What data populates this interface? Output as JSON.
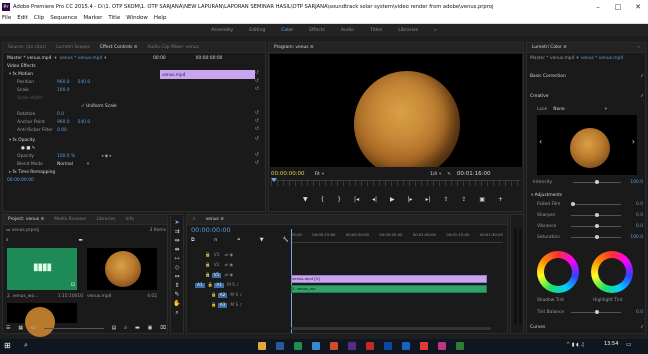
{
  "window": {
    "app_tag": "Pr",
    "title": "Adobe Premiere Pro CC 2015.4 - D:\\1. OTP SKOM\\1. OTP SARJANA\\NEW LAPURAN\\LAPORAN SEMINAR HASIL\\OTP SARJANA\\soundtrack solar system\\video render from adobe\\venus.prproj",
    "controls": [
      "–",
      "□",
      "✕"
    ]
  },
  "menu": [
    "File",
    "Edit",
    "Clip",
    "Sequence",
    "Marker",
    "Title",
    "Window",
    "Help"
  ],
  "workspaces": {
    "items": [
      "Assembly",
      "Editing",
      "Color",
      "Effects",
      "Audio",
      "Titles",
      "Libraries"
    ],
    "active": "Color",
    "more": "»"
  },
  "source_panel": {
    "tabs": [
      "Source: (no clips)",
      "Lumetri Scopes",
      "Effect Controls ≡",
      "Audio Clip Mixer: venus"
    ],
    "active_tab": "Effect Controls ≡",
    "master_clip": "Master * venus.mp4",
    "sequence_clip": "venus * venus.mp4",
    "section": "Video Effects",
    "timecode_left": "00:00",
    "timecode_right": "00:00:00:00",
    "clip_label": "venus.mp4",
    "motion": {
      "label": "Motion",
      "position_label": "Position",
      "position_x": "960.0",
      "position_y": "540.0",
      "scale_label": "Scale",
      "scale_value": "100.0",
      "scale_width_label": "Scale Width",
      "uniform_scale": "Uniform Scale",
      "rotation_label": "Rotation",
      "rotation_value": "0.0",
      "anchor_label": "Anchor Point",
      "anchor_x": "960.0",
      "anchor_y": "540.0",
      "flicker_label": "Anti-flicker Filter",
      "flicker_value": "0.00"
    },
    "opacity": {
      "label": "Opacity",
      "opacity_label": "Opacity",
      "opacity_value": "100.0 %",
      "blend_label": "Blend Mode",
      "blend_value": "Normal"
    },
    "time_remapping": "Time Remapping",
    "bottom_timecode": "00:00:00:00"
  },
  "program_monitor": {
    "tab": "Program: venus ≡",
    "timecode": "00:00:00:00",
    "fit": "Fit",
    "quality": "1/4",
    "duration": "00:01:16:00"
  },
  "lumetri": {
    "tab": "Lumetri Color ≡",
    "clip_master": "Master * venus.mp4",
    "clip_seq": "venus * venus.mp4",
    "basic_correction": "Basic Correction",
    "creative": "Creative",
    "look_label": "Look",
    "look_value": "None",
    "intensity_label": "Intensity",
    "intensity_value": "100.0",
    "adjustments": "Adjustments",
    "sliders": [
      {
        "label": "Faded Film",
        "value": "0.0"
      },
      {
        "label": "Sharpen",
        "value": "0.0"
      },
      {
        "label": "Vibrance",
        "value": "0.0"
      },
      {
        "label": "Saturation",
        "value": "100.0"
      }
    ],
    "shadow_tint": "Shadow Tint",
    "highlight_tint": "Highlight Tint",
    "tint_balance_label": "Tint Balance",
    "tint_balance_value": "0.0",
    "curves": "Curves"
  },
  "project_panel": {
    "tabs": [
      "Project: venus ≡",
      "Media Browser",
      "Libraries",
      "Info"
    ],
    "project_file": "venus.prproj",
    "item_count": "3 Items",
    "items": [
      {
        "name": "2. venus_wo...",
        "duration": "1:15:10010"
      },
      {
        "name": "venus.mp4",
        "duration": "4:02"
      }
    ]
  },
  "timeline": {
    "tab": "venus ≡",
    "timecode": "00:00:00:00",
    "ruler": [
      "00:00",
      "00:00:15:00",
      "00:00:30:00",
      "00:00:45:00",
      "00:01:00:00",
      "00:01:15:00",
      "00:01:30:00"
    ],
    "tracks": [
      {
        "name": "V3"
      },
      {
        "name": "V2"
      },
      {
        "name": "V1"
      },
      {
        "name": "A1"
      },
      {
        "name": "A2"
      },
      {
        "name": "A3"
      }
    ],
    "video_clip_label": "venus.mp4 [V]",
    "audio_clip_label": "2. venus_wo"
  },
  "taskbar": {
    "time": "13:54",
    "date": "1/4/2020"
  },
  "colors": {
    "accent": "#5b9fe0",
    "clip_video": "#c9a5ef",
    "clip_audio": "#2fa36a",
    "program_timecode": "#e7c94a"
  }
}
